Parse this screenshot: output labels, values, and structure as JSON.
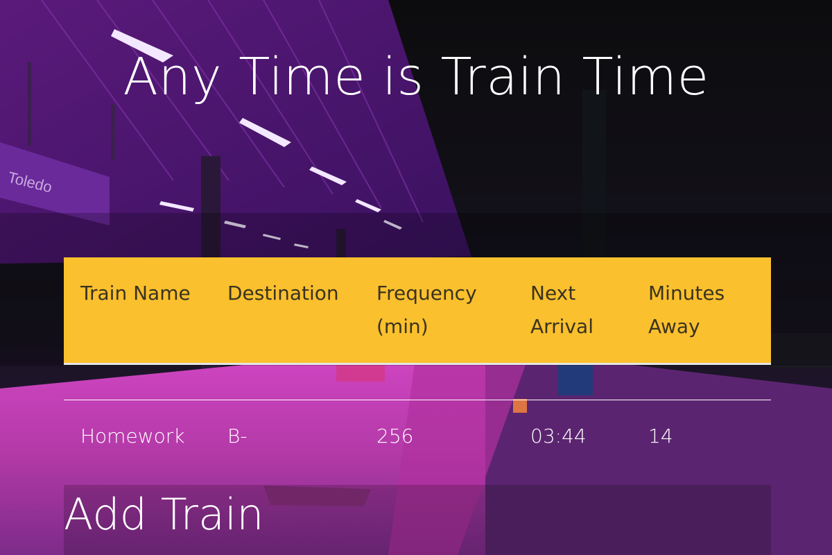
{
  "page": {
    "title": "Any Time is Train Time",
    "sign_text": "Toledo"
  },
  "schedule": {
    "headers": [
      "Train Name",
      "Destination",
      "Frequency (min)",
      "Next Arrival",
      "Minutes Away"
    ],
    "rows": [
      {
        "name": "Homework",
        "destination": "B-",
        "frequency": "256",
        "next_arrival": "03:44",
        "minutes_away": "14"
      }
    ]
  },
  "form": {
    "title": "Add Train"
  },
  "colors": {
    "header_bg": "#fbc02d",
    "accent": "#e040d8"
  }
}
